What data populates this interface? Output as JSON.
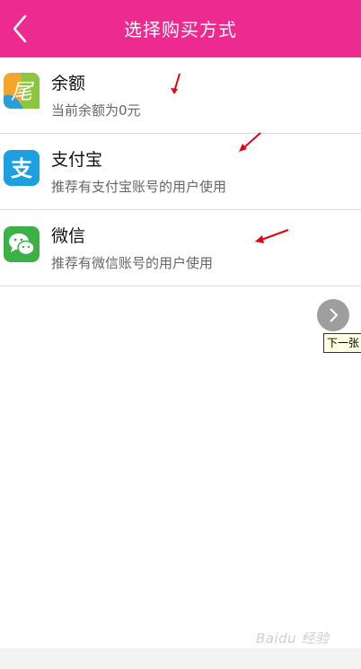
{
  "header": {
    "title": "选择购买方式"
  },
  "options": [
    {
      "title": "余额",
      "subtitle": "当前余额为0元",
      "icon": "balance-logo-icon"
    },
    {
      "title": "支付宝",
      "subtitle": "推荐有支付宝账号的用户使用",
      "icon": "alipay-icon"
    },
    {
      "title": "微信",
      "subtitle": "推荐有微信账号的用户使用",
      "icon": "wechat-icon"
    }
  ],
  "tooltip": {
    "label": "下一张"
  },
  "watermark": {
    "text": "Baidu 经验"
  },
  "colors": {
    "header_bg": "#ec2a8f",
    "alipay": "#1e9fe0",
    "wechat": "#3bb148",
    "annotation_arrow": "#e60012"
  }
}
